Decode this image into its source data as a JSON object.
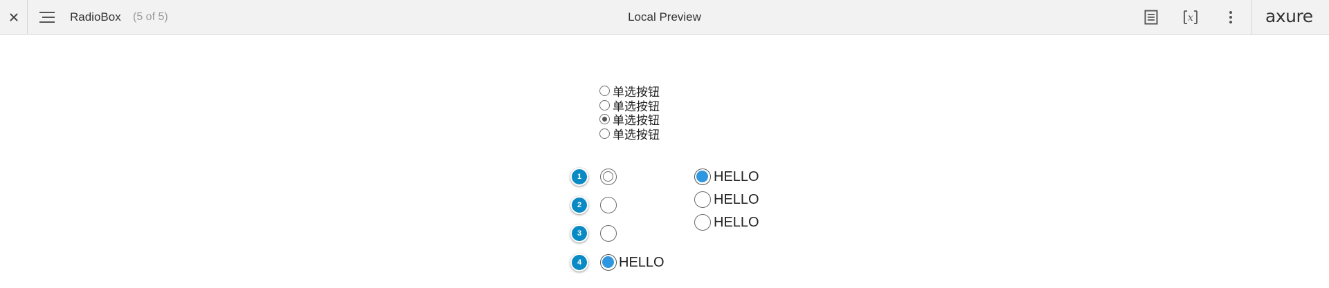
{
  "toolbar": {
    "page_name": "RadioBox",
    "page_count": "(5 of 5)",
    "title": "Local Preview",
    "close_icon": "close-icon",
    "menu_icon": "hamburger-menu-icon",
    "notes_icon": "notes-icon",
    "variables_icon": "variables-icon",
    "more_icon": "more-vertical-icon",
    "logo": "axure"
  },
  "radio_group": {
    "items": [
      {
        "label": "单选按钮",
        "checked": false
      },
      {
        "label": "单选按钮",
        "checked": false
      },
      {
        "label": "单选按钮",
        "checked": true
      },
      {
        "label": "单选按钮",
        "checked": false
      }
    ]
  },
  "annotated_radios": [
    {
      "badge": "1",
      "label": "",
      "style": "double",
      "checked": false
    },
    {
      "badge": "2",
      "label": "",
      "style": "plain",
      "checked": false
    },
    {
      "badge": "3",
      "label": "",
      "style": "plain",
      "checked": false
    },
    {
      "badge": "4",
      "label": "HELLO",
      "style": "filled",
      "checked": true
    }
  ],
  "hello_group": {
    "items": [
      {
        "label": "HELLO",
        "checked": true
      },
      {
        "label": "HELLO",
        "checked": false
      },
      {
        "label": "HELLO",
        "checked": false
      }
    ]
  },
  "colors": {
    "toolbar_bg": "#f2f2f2",
    "badge_blue": "#0a8ac4",
    "radio_fill_blue": "#2f97e0"
  }
}
